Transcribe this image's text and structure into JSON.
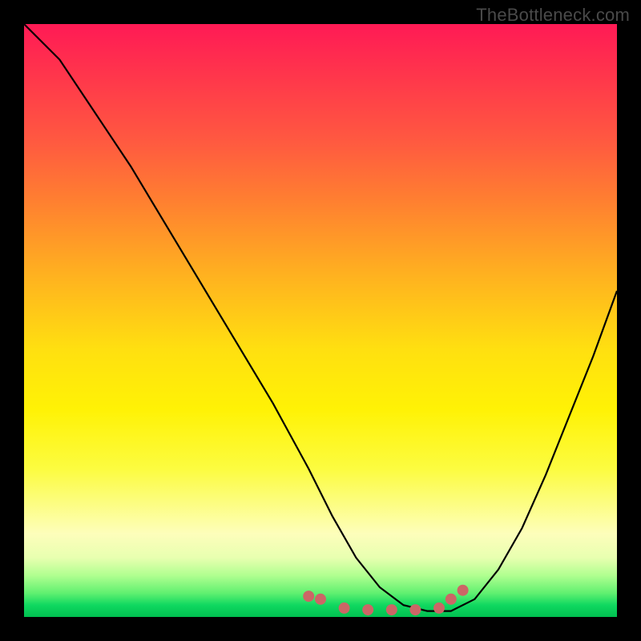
{
  "watermark": "TheBottleneck.com",
  "chart_data": {
    "type": "line",
    "title": "",
    "xlabel": "",
    "ylabel": "",
    "xlim": [
      0,
      100
    ],
    "ylim": [
      0,
      100
    ],
    "series": [
      {
        "name": "bottleneck-curve",
        "x": [
          0,
          6,
          12,
          18,
          24,
          30,
          36,
          42,
          48,
          52,
          56,
          60,
          64,
          68,
          72,
          76,
          80,
          84,
          88,
          92,
          96,
          100
        ],
        "y": [
          100,
          94,
          85,
          76,
          66,
          56,
          46,
          36,
          25,
          17,
          10,
          5,
          2,
          1,
          1,
          3,
          8,
          15,
          24,
          34,
          44,
          55
        ],
        "color": "#000000"
      },
      {
        "name": "optimal-zone-dots",
        "x": [
          48,
          50,
          54,
          58,
          62,
          66,
          70,
          72,
          74
        ],
        "y": [
          3.5,
          3.0,
          1.5,
          1.2,
          1.2,
          1.2,
          1.5,
          3.0,
          4.5
        ],
        "color": "#cc6666"
      }
    ]
  },
  "colors": {
    "frame": "#000000",
    "curve": "#000000",
    "dots": "#cc6666",
    "gradient_top": "#ff1a55",
    "gradient_mid": "#ffe010",
    "gradient_bottom": "#00c050"
  }
}
